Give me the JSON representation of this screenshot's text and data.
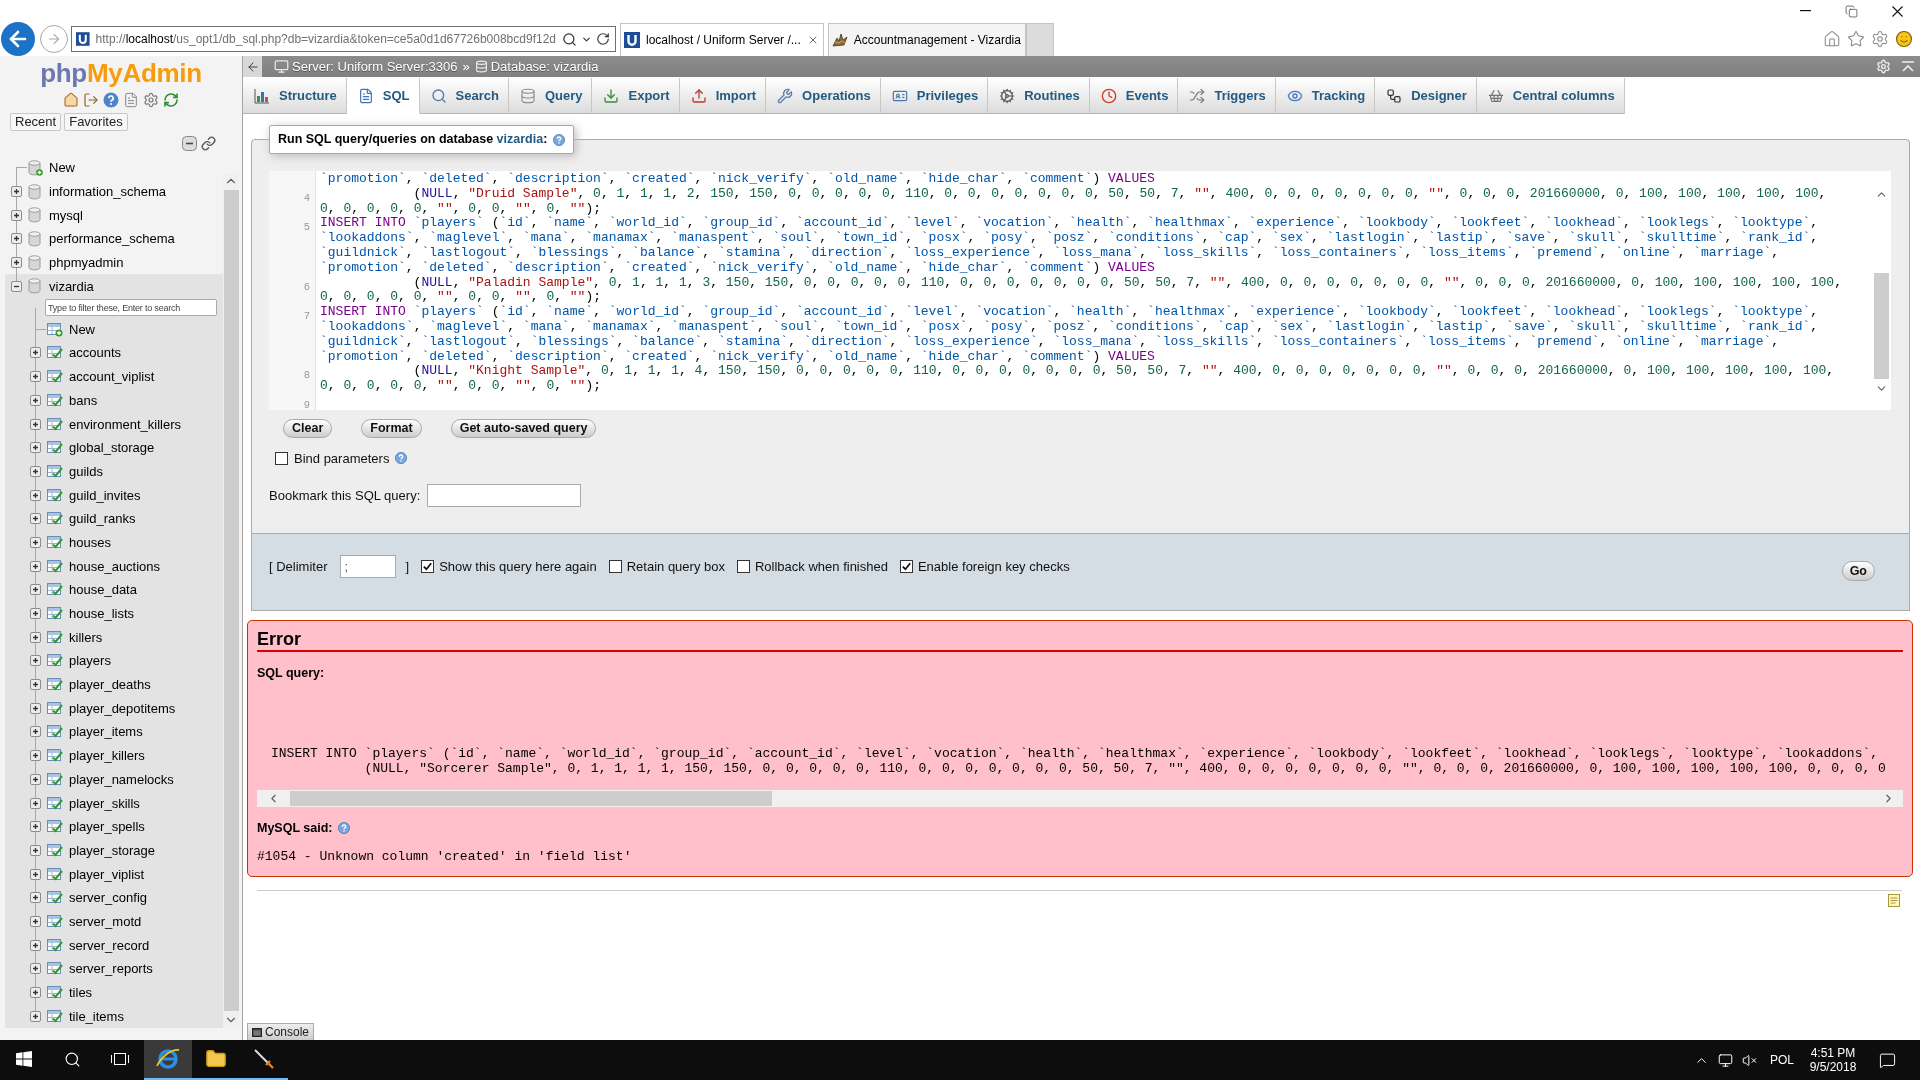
{
  "browser": {
    "address": {
      "scheme": "http://",
      "host": "localhost",
      "path": "/us_opt1/db_sql.php?db=vizardia&token=ce5a0d1d67726b008bcd9f12d"
    },
    "tabs": [
      {
        "title": "localhost / Uniform Server /...",
        "selected": true
      },
      {
        "title": "Accountmanagement - Vizardia",
        "selected": false
      }
    ]
  },
  "navigation": {
    "logo": {
      "prefix": "php",
      "name": "MyAdmin"
    },
    "tabs": [
      "Recent",
      "Favorites"
    ],
    "new_label": "New",
    "databases": [
      {
        "name": "information_schema",
        "expanded": false,
        "selected": false
      },
      {
        "name": "mysql",
        "expanded": false,
        "selected": false
      },
      {
        "name": "performance_schema",
        "expanded": false,
        "selected": false
      },
      {
        "name": "phpmyadmin",
        "expanded": false,
        "selected": false
      },
      {
        "name": "vizardia",
        "expanded": true,
        "selected": true,
        "filter_placeholder": "Type to filter these, Enter to search",
        "new_label": "New",
        "children": [
          {
            "name": "accounts",
            "expanded": false
          },
          {
            "name": "account_viplist",
            "expanded": false
          },
          {
            "name": "bans",
            "expanded": false
          },
          {
            "name": "environment_killers",
            "expanded": false
          },
          {
            "name": "global_storage",
            "expanded": false
          },
          {
            "name": "guilds",
            "expanded": false
          },
          {
            "name": "guild_invites",
            "expanded": false
          },
          {
            "name": "guild_ranks",
            "expanded": false
          },
          {
            "name": "houses",
            "expanded": false
          },
          {
            "name": "house_auctions",
            "expanded": false
          },
          {
            "name": "house_data",
            "expanded": false
          },
          {
            "name": "house_lists",
            "expanded": false
          },
          {
            "name": "killers",
            "expanded": false
          },
          {
            "name": "players",
            "expanded": false
          },
          {
            "name": "player_deaths",
            "expanded": false
          },
          {
            "name": "player_depotitems",
            "expanded": false
          },
          {
            "name": "player_items",
            "expanded": false
          },
          {
            "name": "player_killers",
            "expanded": false
          },
          {
            "name": "player_namelocks",
            "expanded": false
          },
          {
            "name": "player_skills",
            "expanded": false
          },
          {
            "name": "player_spells",
            "expanded": false
          },
          {
            "name": "player_storage",
            "expanded": false
          },
          {
            "name": "player_viplist",
            "expanded": false
          },
          {
            "name": "server_config",
            "expanded": false
          },
          {
            "name": "server_motd",
            "expanded": false
          },
          {
            "name": "server_record",
            "expanded": false
          },
          {
            "name": "server_reports",
            "expanded": false
          },
          {
            "name": "tiles",
            "expanded": false
          },
          {
            "name": "tile_items",
            "expanded": false
          }
        ]
      }
    ]
  },
  "breadcrumb": {
    "items": [
      "Server: Uniform Server:3306",
      "Database: vizardia"
    ],
    "separator": "»"
  },
  "menu_tabs": [
    {
      "label": "Structure",
      "selected": false
    },
    {
      "label": "SQL",
      "selected": true
    },
    {
      "label": "Search",
      "selected": false
    },
    {
      "label": "Query",
      "selected": false
    },
    {
      "label": "Export",
      "selected": false
    },
    {
      "label": "Import",
      "selected": false
    },
    {
      "label": "Operations",
      "selected": false
    },
    {
      "label": "Privileges",
      "selected": false
    },
    {
      "label": "Routines",
      "selected": false
    },
    {
      "label": "Events",
      "selected": false
    },
    {
      "label": "Triggers",
      "selected": false
    },
    {
      "label": "Tracking",
      "selected": false
    },
    {
      "label": "Designer",
      "selected": false
    },
    {
      "label": "Central columns",
      "selected": false
    }
  ],
  "sql_box": {
    "legend": {
      "text": "Run SQL query/queries on database",
      "link": "vizardia",
      "suffix": ":"
    },
    "code_lines": [
      {
        "rows": [
          "`promotion`, `deleted`, `description`, `created`, `nick_verify`, `old_name`, `hide_char`, `comment`) VALUES"
        ]
      },
      {
        "number": "4",
        "rows": [
          "            (NULL, \"Druid Sample\", 0, 1, 1, 1, 2, 150, 150, 0, 0, 0, 0, 0, 110, 0, 0, 0, 0, 0, 0, 0, 50, 50, 7, \"\", 400, 0, 0, 0, 0, 0, 0, 0, \"\", 0, 0, 0, 201660000, 0, 100, 100, 100, 100, 100,",
          "0, 0, 0, 0, 0, \"\", 0, 0, \"\", 0, \"\");"
        ]
      },
      {
        "number": "5",
        "rows": [
          "INSERT INTO `players` (`id`, `name`, `world_id`, `group_id`, `account_id`, `level`, `vocation`, `health`, `healthmax`, `experience`, `lookbody`, `lookfeet`, `lookhead`, `looklegs`, `looktype`,",
          "`lookaddons`, `maglevel`, `mana`, `manamax`, `manaspent`, `soul`, `town_id`, `posx`, `posy`, `posz`, `conditions`, `cap`, `sex`, `lastlogin`, `lastip`, `save`, `skull`, `skulltime`, `rank_id`,",
          "`guildnick`, `lastlogout`, `blessings`, `balance`, `stamina`, `direction`, `loss_experience`, `loss_mana`, `loss_skills`, `loss_containers`, `loss_items`, `premend`, `online`, `marriage`,",
          "`promotion`, `deleted`, `description`, `created`, `nick_verify`, `old_name`, `hide_char`, `comment`) VALUES"
        ]
      },
      {
        "number": "6",
        "rows": [
          "            (NULL, \"Paladin Sample\", 0, 1, 1, 1, 3, 150, 150, 0, 0, 0, 0, 0, 110, 0, 0, 0, 0, 0, 0, 0, 50, 50, 7, \"\", 400, 0, 0, 0, 0, 0, 0, 0, \"\", 0, 0, 0, 201660000, 0, 100, 100, 100, 100, 100,",
          "0, 0, 0, 0, 0, \"\", 0, 0, \"\", 0, \"\");"
        ]
      },
      {
        "number": "7",
        "rows": [
          "INSERT INTO `players` (`id`, `name`, `world_id`, `group_id`, `account_id`, `level`, `vocation`, `health`, `healthmax`, `experience`, `lookbody`, `lookfeet`, `lookhead`, `looklegs`, `looktype`,",
          "`lookaddons`, `maglevel`, `mana`, `manamax`, `manaspent`, `soul`, `town_id`, `posx`, `posy`, `posz`, `conditions`, `cap`, `sex`, `lastlogin`, `lastip`, `save`, `skull`, `skulltime`, `rank_id`,",
          "`guildnick`, `lastlogout`, `blessings`, `balance`, `stamina`, `direction`, `loss_experience`, `loss_mana`, `loss_skills`, `loss_containers`, `loss_items`, `premend`, `online`, `marriage`,",
          "`promotion`, `deleted`, `description`, `created`, `nick_verify`, `old_name`, `hide_char`, `comment`) VALUES"
        ]
      },
      {
        "number": "8",
        "rows": [
          "            (NULL, \"Knight Sample\", 0, 1, 1, 1, 4, 150, 150, 0, 0, 0, 0, 0, 110, 0, 0, 0, 0, 0, 0, 0, 50, 50, 7, \"\", 400, 0, 0, 0, 0, 0, 0, 0, \"\", 0, 0, 0, 201660000, 0, 100, 100, 100, 100, 100,",
          "0, 0, 0, 0, 0, \"\", 0, 0, \"\", 0, \"\");"
        ]
      },
      {
        "number": "9"
      }
    ],
    "buttons": [
      "Clear",
      "Format",
      "Get auto-saved query"
    ],
    "bind_parameters": {
      "label": "Bind parameters",
      "checked": false
    },
    "bookmark_label": "Bookmark this SQL query:"
  },
  "options": {
    "delimiter_open": "[ Delimiter",
    "delimiter_value": ";",
    "delimiter_close": "]",
    "checkboxes": [
      {
        "label": "Show this query here again",
        "checked": true
      },
      {
        "label": "Retain query box",
        "checked": false
      },
      {
        "label": "Rollback when finished",
        "checked": false
      },
      {
        "label": "Enable foreign key checks",
        "checked": true
      }
    ],
    "go": "Go"
  },
  "error": {
    "title": "Error",
    "sql_label": "SQL query:",
    "sql_lines": [
      "INSERT INTO `players` (`id`, `name`, `world_id`, `group_id`, `account_id`, `level`, `vocation`, `health`, `healthmax`, `experience`, `lookbody`, `lookfeet`, `lookhead`, `looklegs`, `looktype`, `lookaddons`,",
      "            (NULL, \"Sorcerer Sample\", 0, 1, 1, 1, 1, 150, 150, 0, 0, 0, 0, 0, 110, 0, 0, 0, 0, 0, 0, 0, 50, 50, 7, \"\", 400, 0, 0, 0, 0, 0, 0, 0, \"\", 0, 0, 0, 201660000, 0, 100, 100, 100, 100, 100, 0, 0, 0, 0"
    ],
    "said_label": "MySQL said:",
    "message": "#1054 - Unknown column 'created' in 'field list'"
  },
  "console": "Console",
  "taskbar": {
    "apps": [
      {
        "selected": true,
        "running": true
      },
      {
        "selected": false,
        "running": true
      },
      {
        "selected": false,
        "running": true
      }
    ],
    "language": "POL",
    "time": "4:51 PM",
    "date": "9/5/2018"
  }
}
